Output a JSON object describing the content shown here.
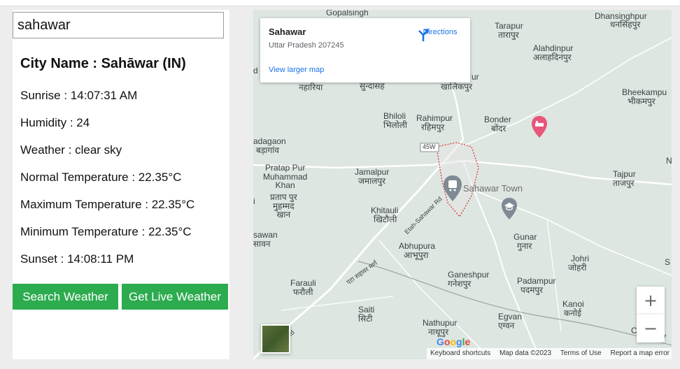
{
  "search": {
    "value": "sahawar"
  },
  "weather": {
    "city_title": "City Name : Sahāwar (IN)",
    "sunrise": "Sunrise : 14:07:31 AM",
    "humidity": "Humidity : 24",
    "weather": "Weather : clear sky",
    "normal_temp": "Normal Temperature : 22.35°C",
    "max_temp": "Maximum Temperature : 22.35°C",
    "min_temp": "Minimum Temperature : 22.35°C",
    "sunset": "Sunset : 14:08:11 PM"
  },
  "buttons": {
    "search": "Search Weather",
    "live": "Get Live Weather"
  },
  "colors": {
    "button_green": "#2dab4f",
    "link_blue": "#1a73e8",
    "pin_red": "#e8557a",
    "map_bg": "#dde6e0"
  },
  "map": {
    "card": {
      "place": "Sahawar",
      "address": "Uttar Pradesh 207245",
      "directions": "Directions",
      "larger_map": "View larger map",
      "directions_icon": "directions-arrow-icon"
    },
    "labels": {
      "gopalsingh": "Gopalsingh",
      "dhansinghpur": "Dhansinghpur",
      "dhansinghpur_hi": "धनसिंहपुर",
      "tarapur": "Tarapur",
      "tarapur_hi": "तारापुर",
      "alahdinpur": "Alahdinpur",
      "alahdinpur_hi": "अलाहदिनपुर",
      "naharia_hi": "नहारिया",
      "sundasah_hi": "सुन्दासह",
      "khalikpur_hi": "खालिकपुर",
      "ur": "ur",
      "bheekampur": "Bheekampu",
      "bheekampur_hi": "भीकमपुर",
      "bholi": "Bhiloli",
      "bholi_hi": "भिलोली",
      "rahimpur": "Rahimpur",
      "rahimpur_hi": "रहिमपुर",
      "bonder": "Bonder",
      "bonder_hi": "बोंदर",
      "adagaon": "adagaon",
      "adagaon_hi": "बड़ागांव",
      "route": "45W",
      "pratap": "Pratap Pur\nMuhammad\nKhan",
      "pratap_hi": "प्रताप पुर\nमुहम्मद\nखान",
      "jamalpur": "Jamalpur",
      "jamalpur_hi": "जमालपुर",
      "sahawar_town": "Sahawar Town",
      "tajpur": "Tajpur",
      "tajpur_hi": "ताजपुर",
      "khitauli": "Khitauli",
      "khitauli_hi": "खिटौली",
      "etah_rd": "Etah-Sahawar Rd",
      "sawan": "sawan",
      "sawan_hi": "सावन",
      "abhupura": "Abhupura",
      "abhupura_hi": "आभूपुरा",
      "gunar": "Gunar",
      "gunar_hi": "गुनार",
      "johri": "Johri",
      "johri_hi": "जोहरी",
      "road_hi": "एटा सहावर मार्ग",
      "ganeshpur": "Ganeshpur",
      "ganeshpur_hi": "गनेशपुर",
      "farauli": "Farauli",
      "farauli_hi": "फरौली",
      "padampur": "Padampur",
      "padampur_hi": "पदमपुर",
      "kanoi": "Kanoi",
      "kanoi_hi": "कनोई",
      "saiti": "Saiti",
      "saiti_hi": "सिटी",
      "egvan": "Egvan",
      "egvan_hi": "एग्वन",
      "nathupur": "Nathupur",
      "nathupur_hi": "नाथूपुर",
      "rd": "Rd",
      "y": "y",
      "c": "C",
      "s": "S",
      "d": "d",
      "i": "i",
      "n": "N"
    },
    "google_logo": "Google",
    "attribution": {
      "shortcuts": "Keyboard shortcuts",
      "data": "Map data ©2023",
      "terms": "Terms of Use",
      "report": "Report a map error"
    },
    "zoom_in": "+",
    "zoom_out": "−"
  }
}
